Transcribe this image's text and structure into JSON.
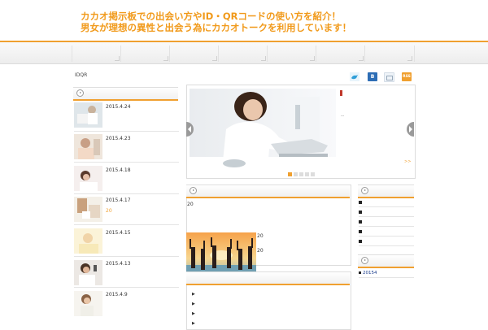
{
  "header": {
    "title_line1": "カカオ掲示板での出会い方やID・QRコードの使い方を紹介！",
    "title_line2": "男女が理想の異性と出会う為にカカオトークを利用しています！"
  },
  "breadcrumb": "IDQR",
  "share": {
    "bookmark_label": "B",
    "feed_label": "RSS"
  },
  "sidebar_posts": [
    {
      "date": "2015.4.24"
    },
    {
      "date": "2015.4.23"
    },
    {
      "date": "2015.4.18"
    },
    {
      "date": "2015.4.17",
      "sub": "20"
    },
    {
      "date": "2015.4.15"
    },
    {
      "date": "2015.4.13"
    },
    {
      "date": "2015.4.9"
    }
  ],
  "slider": {
    "side_text": "--",
    "more": ">>"
  },
  "content_box": {
    "line1": "20",
    "line2": "20",
    "line3": "20"
  },
  "right_box2": {
    "link": "20154"
  },
  "colors": {
    "accent": "#f0a030",
    "title": "#f19a1b"
  }
}
